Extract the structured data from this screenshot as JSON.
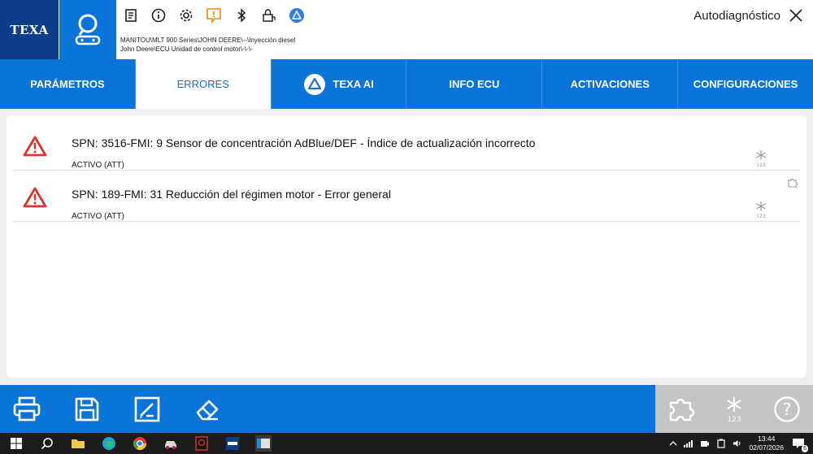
{
  "header": {
    "logo_text": "TEXA",
    "path_line1": "MANITOU\\MLT 900 Series\\JOHN DEERE\\--\\Inyección diesel",
    "path_line2": "John Deere\\ECU Unidad de control motor\\-\\-\\-",
    "mode_title": "Autodiagnóstico",
    "icons": [
      "document-icon",
      "info-icon",
      "gear-icon",
      "warning-chat-icon",
      "bluetooth-icon",
      "lock-icon",
      "texa-ai-icon"
    ]
  },
  "tabs": [
    {
      "label": "PARÁMETROS",
      "active": false
    },
    {
      "label": "ERRORES",
      "active": true
    },
    {
      "label": "TEXA AI",
      "active": false
    },
    {
      "label": "INFO ECU",
      "active": false
    },
    {
      "label": "ACTIVACIONES",
      "active": false
    },
    {
      "label": "CONFIGURACIONES",
      "active": false
    }
  ],
  "errors": [
    {
      "title": "SPN: 3516-FMI: 9 Sensor de concentración AdBlue/DEF - Índice de actualización incorrecto",
      "status": "ACTIVO (ATT)"
    },
    {
      "title": "SPN: 189-FMI: 31 Reducción del régimen motor - Error general",
      "status": "ACTIVO (ATT)"
    }
  ],
  "toolbar": {
    "left_buttons": [
      "print-icon",
      "save-icon",
      "edit-icon",
      "eraser-icon"
    ],
    "right_buttons": [
      "puzzle-icon",
      "freeze-frame-icon",
      "help-icon"
    ],
    "snow_label": "123",
    "help_label": "?"
  },
  "taskbar": {
    "time": "13:44",
    "date": "02/07/2026",
    "notification_count": "6"
  },
  "colors": {
    "brand_blue": "#0a74d9",
    "logo_navy": "#0d3c88",
    "warning_red": "#e03131",
    "orange_accent": "#f08c00"
  }
}
